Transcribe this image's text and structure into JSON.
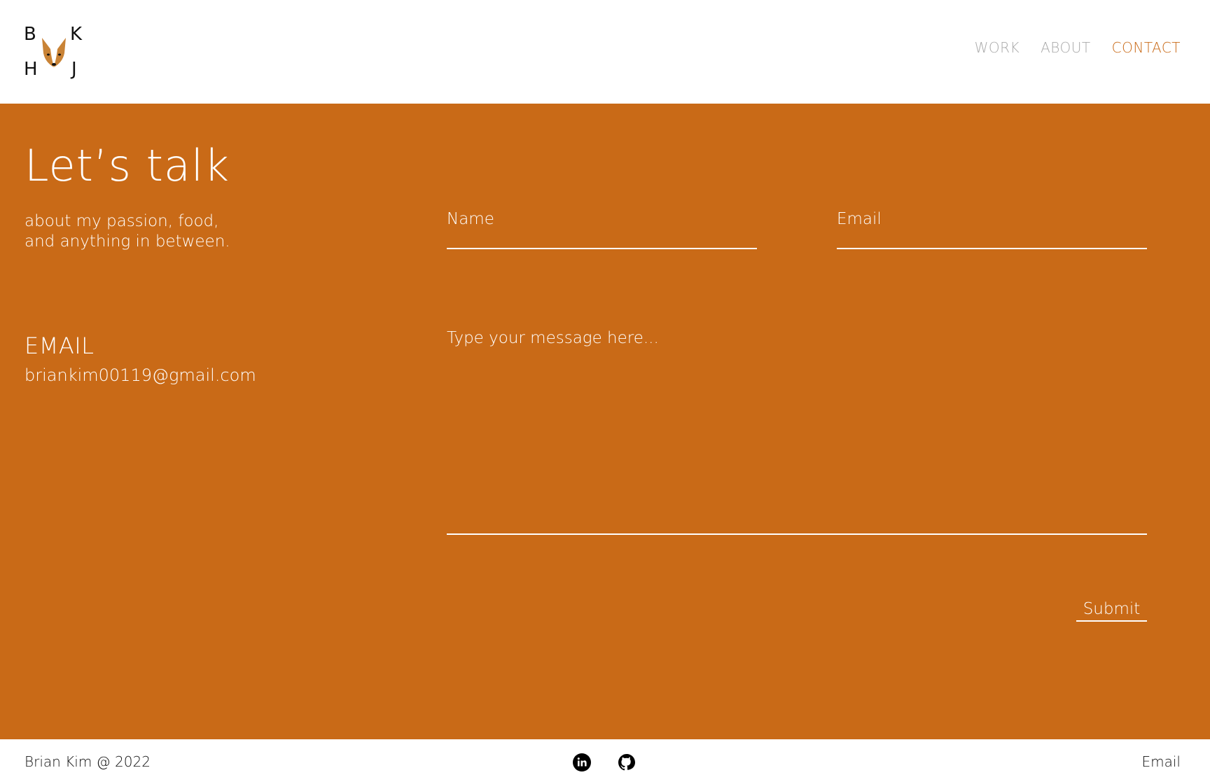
{
  "header": {
    "logo": {
      "letters": [
        "B",
        "K",
        "H",
        "J"
      ],
      "icon": "dog-face-icon"
    },
    "nav": [
      {
        "label": "WORK",
        "active": false
      },
      {
        "label": "ABOUT",
        "active": false
      },
      {
        "label": "CONTACT",
        "active": true
      }
    ]
  },
  "contact": {
    "title": "Let’s talk",
    "subtitle_line1": "about my passion, food,",
    "subtitle_line2": "and anything in between.",
    "email_heading": "EMAIL",
    "email_address": "briankim00119@gmail.com"
  },
  "form": {
    "name_placeholder": "Name",
    "name_value": "",
    "email_placeholder": "Email",
    "email_value": "",
    "message_placeholder": "Type your message here...",
    "message_value": "",
    "submit_label": "Submit"
  },
  "footer": {
    "copyright": "Brian Kim @ 2022",
    "socials": [
      "linkedin-icon",
      "github-icon"
    ],
    "email_link": "Email"
  },
  "colors": {
    "accent": "#c96a17",
    "nav_inactive": "#a9a9a9",
    "text_on_accent": "#ffffff",
    "footer_text": "#111111"
  }
}
